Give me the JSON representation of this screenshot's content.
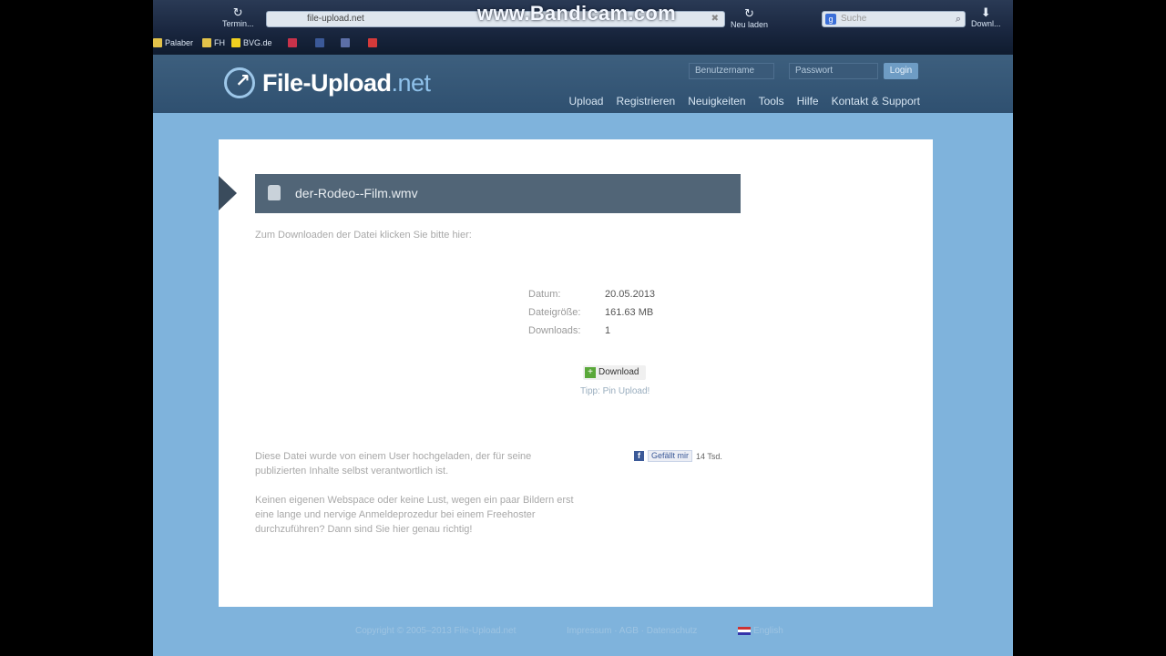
{
  "browser": {
    "back_label": "Termin...",
    "address_url": "file-upload.net",
    "reload_label": "Neu laden",
    "search_placeholder": "Suche",
    "download_label": "Downl...",
    "watermark": "www.Bandicam.com"
  },
  "bookmarks": [
    {
      "label": "Palaber",
      "color": "#e2c24a"
    },
    {
      "label": "FH",
      "color": "#e2c24a"
    },
    {
      "label": "BVG.de",
      "color": "#f0d020"
    },
    {
      "label": "",
      "color": "#c8324a"
    },
    {
      "label": "",
      "color": "#3b5998"
    },
    {
      "label": "",
      "color": "#5c6fa8"
    },
    {
      "label": "",
      "color": "#d43a3a"
    }
  ],
  "site": {
    "logo_main": "File-Upload",
    "logo_tld": ".net",
    "username_placeholder": "Benutzername",
    "password_placeholder": "Passwort",
    "login_label": "Login",
    "nav": [
      "Upload",
      "Registrieren",
      "Neuigkeiten",
      "Tools",
      "Hilfe",
      "Kontakt & Support"
    ]
  },
  "file": {
    "name": "der-Rodeo--Film.wmv",
    "intro": "Zum Downloaden der Datei klicken Sie bitte hier:",
    "info": [
      {
        "label": "Datum:",
        "value": "20.05.2013"
      },
      {
        "label": "Dateigröße:",
        "value": "161.63 MB"
      },
      {
        "label": "Downloads:",
        "value": "1"
      }
    ],
    "download_label": "Download",
    "tipp": "Tipp: Pin Upload!"
  },
  "descriptions": {
    "text1": "Diese Datei wurde von einem User hochgeladen, der für seine publizierten Inhalte selbst verantwortlich ist.",
    "text2": "Keinen eigenen Webspace oder keine Lust, wegen ein paar Bildern erst eine lange und nervige Anmeldeprozedur bei einem Freehoster durchzuführen? Dann sind Sie hier genau richtig!"
  },
  "facebook": {
    "like_label": "Gefällt mir",
    "count": "14 Tsd."
  },
  "footer": {
    "copyright": "Copyright © 2005–2013 File-Upload.net",
    "links": "Impressum · AGB · Datenschutz",
    "language": "English"
  }
}
